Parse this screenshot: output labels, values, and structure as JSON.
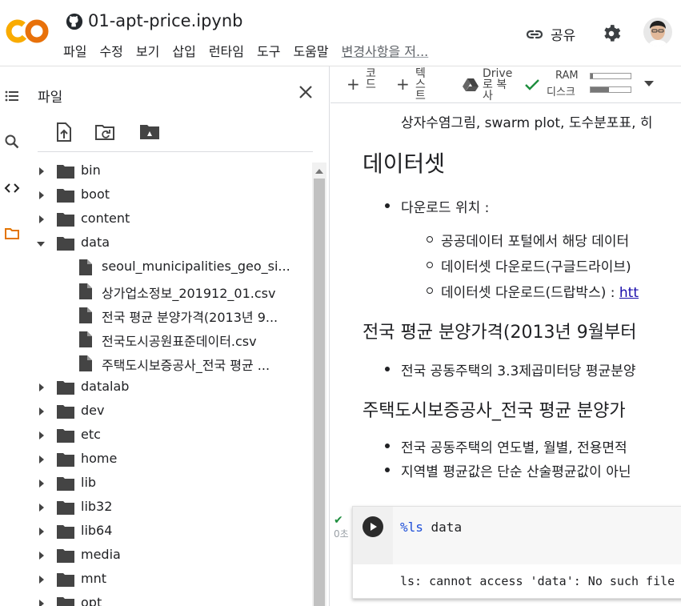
{
  "app": {
    "title": "01-apt-price.ipynb",
    "menu": [
      "파일",
      "수정",
      "보기",
      "삽입",
      "런타임",
      "도구",
      "도움말"
    ],
    "changes_label": "변경사항을 저...",
    "share_label": "공유"
  },
  "rail": {
    "icons": [
      "toc-icon",
      "search-icon",
      "code-icon",
      "folder-icon"
    ]
  },
  "files": {
    "title": "파일",
    "tree": [
      {
        "label": "bin",
        "type": "folder",
        "expanded": false,
        "depth": 0
      },
      {
        "label": "boot",
        "type": "folder",
        "expanded": false,
        "depth": 0
      },
      {
        "label": "content",
        "type": "folder",
        "expanded": false,
        "depth": 0
      },
      {
        "label": "data",
        "type": "folder",
        "expanded": true,
        "depth": 0
      },
      {
        "label": "seoul_municipalities_geo_si...",
        "type": "file",
        "depth": 1
      },
      {
        "label": "상가업소정보_201912_01.csv",
        "type": "file",
        "depth": 1
      },
      {
        "label": "전국 평균 분양가격(2013년 9...",
        "type": "file",
        "depth": 1
      },
      {
        "label": "전국도시공원표준데이터.csv",
        "type": "file",
        "depth": 1
      },
      {
        "label": "주택도시보증공사_전국 평균 ...",
        "type": "file",
        "depth": 1
      },
      {
        "label": "datalab",
        "type": "folder",
        "expanded": false,
        "depth": 0
      },
      {
        "label": "dev",
        "type": "folder",
        "expanded": false,
        "depth": 0
      },
      {
        "label": "etc",
        "type": "folder",
        "expanded": false,
        "depth": 0
      },
      {
        "label": "home",
        "type": "folder",
        "expanded": false,
        "depth": 0
      },
      {
        "label": "lib",
        "type": "folder",
        "expanded": false,
        "depth": 0
      },
      {
        "label": "lib32",
        "type": "folder",
        "expanded": false,
        "depth": 0
      },
      {
        "label": "lib64",
        "type": "folder",
        "expanded": false,
        "depth": 0
      },
      {
        "label": "media",
        "type": "folder",
        "expanded": false,
        "depth": 0
      },
      {
        "label": "mnt",
        "type": "folder",
        "expanded": false,
        "depth": 0
      },
      {
        "label": "opt",
        "type": "folder",
        "expanded": false,
        "depth": 0
      }
    ]
  },
  "toolbar": {
    "code_label": "코드",
    "text_label": "텍스트",
    "drive_label": "Drive로 복사",
    "ram_label": "RAM",
    "disk_label": "디스크",
    "ram_fraction": 0.05,
    "disk_fraction": 0.45
  },
  "notebook": {
    "line_top": "상자수염그림, swarm plot, 도수분포표, 히",
    "h_dataset": "데이터셋",
    "download_label": "다운로드 위치 :",
    "sub1": "공공데이터 포털에서 해당 데이터",
    "sub2": "데이터셋 다운로드(구글드라이브)",
    "sub3_prefix": "데이터셋 다운로드(드랍박스) : ",
    "sub3_link": "htt",
    "h_avg": "전국 평균 분양가격(2013년 9월부터",
    "avg_bullet": "전국 공동주택의 3.3제곱미터당 평균분양",
    "h_hug": "주택도시보증공사_전국 평균 분양가",
    "hug_bullet1": "전국 공동주택의 연도별, 월별, 전용면적",
    "hug_bullet2": "지역별 평균값은 단순 산술평균값이 아닌",
    "cell_magic": "%ls",
    "cell_arg": " data",
    "cell_output": "ls: cannot access 'data': No such file o",
    "exec_time": "0초"
  },
  "colors": {
    "logo_orange": "#f9ab00",
    "check_green": "#1e8e3e",
    "accent": "#e37400"
  }
}
